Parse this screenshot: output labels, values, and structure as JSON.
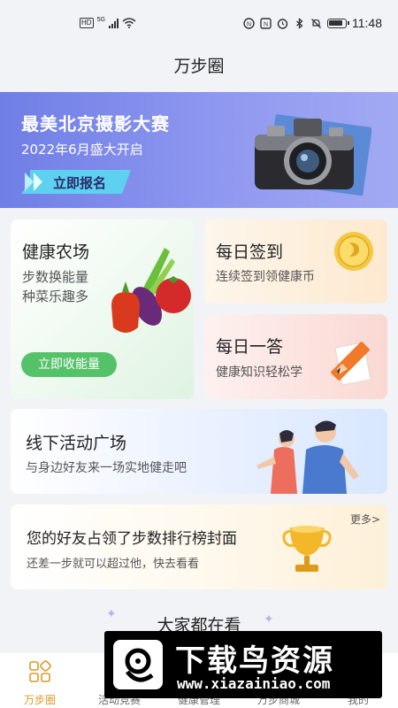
{
  "status_bar": {
    "time": "11:48",
    "network": "5G",
    "hd": "HD",
    "icons": [
      "hd-icon",
      "signal-icon",
      "wifi-icon",
      "nfc-icon",
      "alarm-icon",
      "bluetooth-icon",
      "mute-icon",
      "battery-icon"
    ]
  },
  "page": {
    "title": "万步圈"
  },
  "banner": {
    "title": "最美北京摄影大赛",
    "subtitle": "2022年6月盛大开启",
    "cta": "立即报名",
    "icon": "camera-icon",
    "colors": {
      "background": "#7b88ea",
      "cta": "#5ed0f0"
    }
  },
  "cards": {
    "farm": {
      "title": "健康农场",
      "line1": "步数换能量",
      "line2": "种菜乐趣多",
      "cta": "立即收能量",
      "icon": "vegetables-icon",
      "cta_color": "#55c26a"
    },
    "checkin": {
      "title": "每日签到",
      "subtitle": "连续签到领健康币",
      "icon": "coin-icon"
    },
    "quiz": {
      "title": "每日一答",
      "subtitle": "健康知识轻松学",
      "icon": "pencil-icon"
    },
    "offline": {
      "title": "线下活动广场",
      "subtitle": "与身边好友来一场实地健走吧",
      "icon": "runners-icon"
    },
    "rank": {
      "title": "您的好友占领了步数排行榜封面",
      "subtitle": "还差一步就可以超过他，快去看看",
      "more": "更多>",
      "icon": "trophy-icon"
    }
  },
  "section": {
    "title": "大家都在看"
  },
  "bottom_nav": {
    "items": [
      {
        "label": "万步圈",
        "icon": "steps-circle-icon",
        "active": true
      },
      {
        "label": "活动竞赛",
        "icon": "activity-icon",
        "active": false
      },
      {
        "label": "健康管理",
        "icon": "health-icon",
        "active": false
      },
      {
        "label": "万步商城",
        "icon": "mall-icon",
        "active": false
      },
      {
        "label": "我的",
        "icon": "profile-icon",
        "active": false
      }
    ],
    "active_color": "#d89a2a"
  },
  "watermark": {
    "text": "下载鸟资源",
    "url": "www.xiazainiao.com"
  }
}
